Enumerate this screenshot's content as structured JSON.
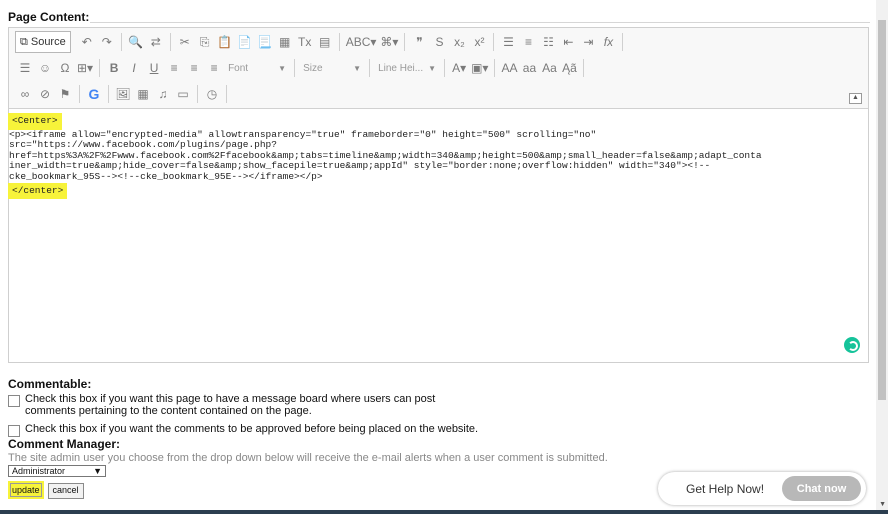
{
  "section_label": "Page Content:",
  "toolbar": {
    "source_label": "Source",
    "row1": [
      {
        "name": "undo-icon",
        "glyph": "↶"
      },
      {
        "name": "redo-icon",
        "glyph": "↷"
      },
      {
        "sep": true
      },
      {
        "name": "find-icon",
        "glyph": "🔍"
      },
      {
        "name": "replace-icon",
        "glyph": "⇄"
      },
      {
        "sep": true
      },
      {
        "name": "cut-icon",
        "glyph": "✂"
      },
      {
        "name": "copy-icon",
        "glyph": "⎘"
      },
      {
        "name": "paste-icon",
        "glyph": "📋"
      },
      {
        "name": "paste-text-icon",
        "glyph": "📄"
      },
      {
        "name": "paste-word-icon",
        "glyph": "📃"
      },
      {
        "name": "format-painter-icon",
        "glyph": "▦"
      },
      {
        "name": "remove-format-icon",
        "glyph": "Tx"
      },
      {
        "name": "templates-icon",
        "glyph": "▤"
      },
      {
        "sep": true
      },
      {
        "name": "spellcheck-icon",
        "glyph": "ABC▾"
      },
      {
        "name": "styles-icon",
        "glyph": "⌘▾"
      },
      {
        "sep": true
      },
      {
        "name": "blockquote-icon",
        "glyph": "❞"
      },
      {
        "name": "strike-icon",
        "glyph": "S"
      },
      {
        "name": "subscript-icon",
        "glyph": "x₂"
      },
      {
        "name": "superscript-icon",
        "glyph": "x²"
      },
      {
        "sep": true
      },
      {
        "name": "numbered-list-icon",
        "glyph": "☰"
      },
      {
        "name": "ordered-list-icon",
        "glyph": "≡"
      },
      {
        "name": "bullet-list-icon",
        "glyph": "☷"
      },
      {
        "name": "outdent-icon",
        "glyph": "⇤"
      },
      {
        "name": "indent-icon",
        "glyph": "⇥"
      },
      {
        "name": "formula-icon",
        "glyph": "fx"
      },
      {
        "sep": true
      }
    ],
    "row2": [
      {
        "name": "align-icon",
        "glyph": "☰"
      },
      {
        "name": "emoji-icon",
        "glyph": "☺"
      },
      {
        "name": "special-char-icon",
        "glyph": "Ω"
      },
      {
        "name": "table-icon",
        "glyph": "⊞▾"
      },
      {
        "sep": true
      },
      {
        "name": "bold-icon",
        "glyph": "B"
      },
      {
        "name": "italic-icon",
        "glyph": "I"
      },
      {
        "name": "underline-icon",
        "glyph": "U"
      },
      {
        "name": "align-left-icon",
        "glyph": "≡"
      },
      {
        "name": "align-center-icon",
        "glyph": "≡"
      },
      {
        "name": "align-right-icon",
        "glyph": "≡"
      }
    ],
    "combos": {
      "font": "Font",
      "size": "Size",
      "line_height": "Line Hei..."
    },
    "row2b": [
      {
        "name": "text-color-icon",
        "glyph": "A▾"
      },
      {
        "name": "bg-color-icon",
        "glyph": "▣▾"
      },
      {
        "sep": true
      },
      {
        "name": "uppercase-icon",
        "glyph": "AA"
      },
      {
        "name": "lowercase-icon",
        "glyph": "aa"
      },
      {
        "name": "capitalize-icon",
        "glyph": "Aa"
      },
      {
        "name": "case-change-icon",
        "glyph": "Ąã"
      },
      {
        "sep": true
      }
    ],
    "row3": [
      {
        "name": "link-icon",
        "glyph": "∞"
      },
      {
        "name": "unlink-icon",
        "glyph": "⊘"
      },
      {
        "name": "anchor-icon",
        "glyph": "⚑"
      },
      {
        "sep": true
      },
      {
        "name": "google-icon",
        "glyph": "G"
      },
      {
        "sep": true
      },
      {
        "name": "image-icon",
        "glyph": "🖼"
      },
      {
        "name": "gallery-icon",
        "glyph": "▦"
      },
      {
        "name": "audio-icon",
        "glyph": "♫"
      },
      {
        "name": "video-icon",
        "glyph": "▭"
      },
      {
        "sep": true
      },
      {
        "name": "iframe-icon",
        "glyph": "◷"
      },
      {
        "sep": true
      }
    ],
    "collapse_glyph": "▲"
  },
  "code": {
    "open_tag": "<Center>",
    "lines": [
      "<p><iframe allow=\"encrypted-media\" allowtransparency=\"true\" frameborder=\"0\" height=\"500\" scrolling=\"no\"",
      "src=\"https://www.facebook.com/plugins/page.php?",
      "href=https%3A%2F%2Fwww.facebook.com%2Ffacebook&amp;tabs=timeline&amp;width=340&amp;height=500&amp;small_header=false&amp;adapt_conta",
      "iner_width=true&amp;hide_cover=false&amp;show_facepile=true&amp;appId\" style=\"border:none;overflow:hidden\" width=\"340\"><!--",
      "cke_bookmark_95S--><!--cke_bookmark_95E--></iframe></p>"
    ],
    "close_tag": "</center>"
  },
  "form": {
    "commentable_title": "Commentable:",
    "commentable_text": "Check this box if you want this page to have a message board where users can post comments pertaining to the content contained on the page.",
    "approve_text": "Check this box if you want the comments to be approved before being placed on the website.",
    "manager_title": "Comment Manager:",
    "manager_hint": "The site admin user you choose from the drop down below will receive the e-mail alerts when a user comment is submitted.",
    "select_value": "Administrator",
    "update_label": "update",
    "cancel_label": "cancel"
  },
  "chat": {
    "text": "Get Help Now!",
    "button": "Chat now"
  },
  "colors": {
    "highlight": "#f7f33a",
    "grammarly": "#15c39a",
    "chat_button": "#b8b8b8"
  }
}
